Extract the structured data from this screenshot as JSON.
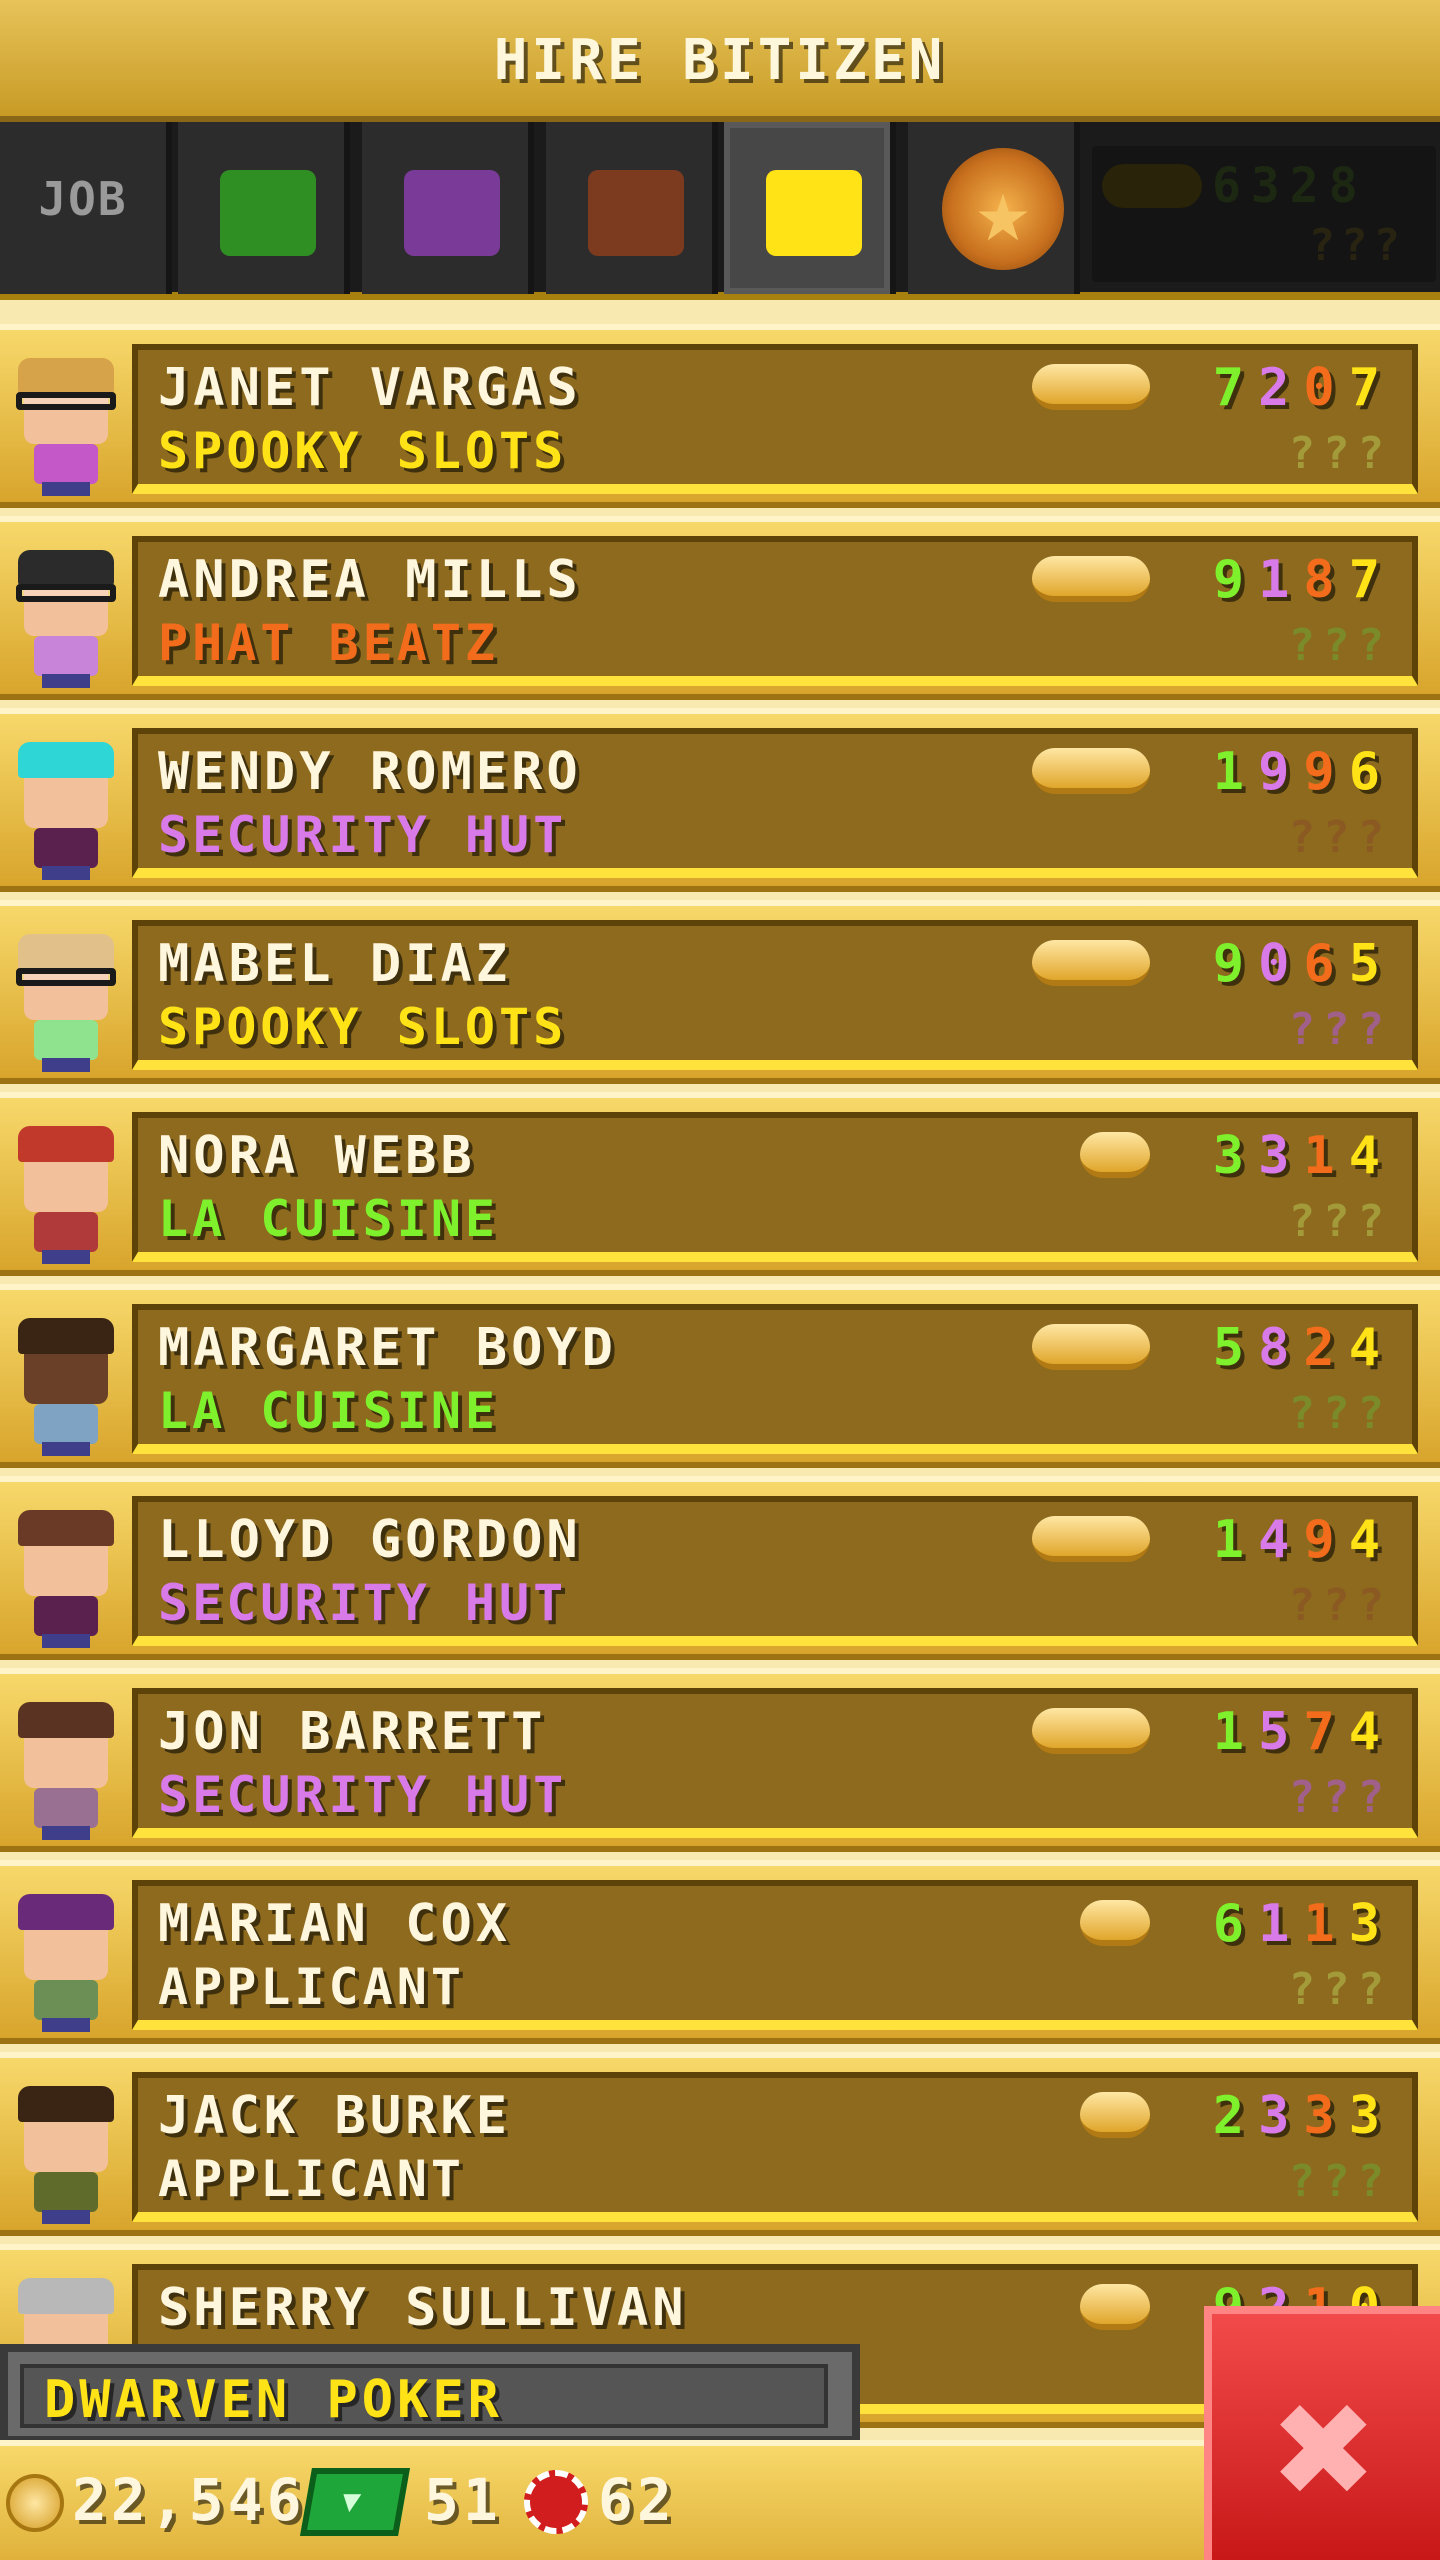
{
  "header": {
    "title": "HIRE BITIZEN"
  },
  "filters": {
    "job_label": "JOB",
    "tabs": [
      {
        "name": "food",
        "color": "#2f8f22"
      },
      {
        "name": "service",
        "color": "#7a3a98"
      },
      {
        "name": "recreation",
        "color": "#7c3a1e"
      },
      {
        "name": "retail",
        "color": "#ffe316",
        "active": true
      },
      {
        "name": "creative",
        "icon": "star-medal-icon"
      }
    ],
    "ghost_stats": "6328",
    "ghost_unknown": "???"
  },
  "bitizens": [
    {
      "name": "JANET VARGAS",
      "job": "SPOOKY SLOTS",
      "job_color": "#ffe316",
      "stats": [
        "7",
        "2",
        "0",
        "7"
      ],
      "coins": 3,
      "unknown": "???",
      "avatar": {
        "hair": "#d7a34a",
        "shirt": "#c558c9",
        "glasses": true
      }
    },
    {
      "name": "ANDREA MILLS",
      "job": "PHAT BEATZ",
      "job_color": "#f36c1c",
      "stats": [
        "9",
        "1",
        "8",
        "7"
      ],
      "coins": 4,
      "unknown": "???",
      "avatar": {
        "hair": "#2b2b2b",
        "shirt": "#c884d9",
        "glasses": true
      }
    },
    {
      "name": "WENDY ROMERO",
      "job": "SECURITY HUT",
      "job_color": "#d87ae8",
      "stats": [
        "1",
        "9",
        "9",
        "6"
      ],
      "coins": 4,
      "unknown": "???",
      "avatar": {
        "hair": "#2ed6d6",
        "shirt": "#5a214e",
        "glasses": false
      }
    },
    {
      "name": "MABEL DIAZ",
      "job": "SPOOKY SLOTS",
      "job_color": "#ffe316",
      "stats": [
        "9",
        "0",
        "6",
        "5"
      ],
      "coins": 3,
      "unknown": "???",
      "avatar": {
        "hair": "#e2c089",
        "shirt": "#8fe38f",
        "glasses": true
      }
    },
    {
      "name": "NORA WEBB",
      "job": "LA CUISINE",
      "job_color": "#7ef02c",
      "stats": [
        "3",
        "3",
        "1",
        "4"
      ],
      "coins": 2,
      "unknown": "???",
      "avatar": {
        "hair": "#c0392b",
        "shirt": "#b03a3a",
        "glasses": false
      }
    },
    {
      "name": "MARGARET BOYD",
      "job": "LA CUISINE",
      "job_color": "#7ef02c",
      "stats": [
        "5",
        "8",
        "2",
        "4"
      ],
      "coins": 3,
      "unknown": "???",
      "avatar": {
        "hair": "#3a2414",
        "shirt": "#7fa3c2",
        "glasses": false,
        "skin": "#6a4128"
      }
    },
    {
      "name": "LLOYD GORDON",
      "job": "SECURITY HUT",
      "job_color": "#d87ae8",
      "stats": [
        "1",
        "4",
        "9",
        "4"
      ],
      "coins": 3,
      "unknown": "???",
      "avatar": {
        "hair": "#6b3a26",
        "shirt": "#5a214e",
        "glasses": false
      }
    },
    {
      "name": "JON BARRETT",
      "job": "SECURITY HUT",
      "job_color": "#d87ae8",
      "stats": [
        "1",
        "5",
        "7",
        "4"
      ],
      "coins": 3,
      "unknown": "???",
      "avatar": {
        "hair": "#5a3322",
        "shirt": "#9a7092",
        "glasses": false
      }
    },
    {
      "name": "MARIAN COX",
      "job": "APPLICANT",
      "job_color": "#fff6de",
      "stats": [
        "6",
        "1",
        "1",
        "3"
      ],
      "coins": 2,
      "unknown": "???",
      "avatar": {
        "hair": "#6a2a7a",
        "shirt": "#6b8f55",
        "glasses": false
      }
    },
    {
      "name": "JACK BURKE",
      "job": "APPLICANT",
      "job_color": "#fff6de",
      "stats": [
        "2",
        "3",
        "3",
        "3"
      ],
      "coins": 2,
      "unknown": "???",
      "avatar": {
        "hair": "#3a2414",
        "shirt": "#5f6b2a",
        "glasses": false
      }
    },
    {
      "name": "SHERRY SULLIVAN",
      "job": "",
      "job_color": "#fff6de",
      "stats": [
        "9",
        "2",
        "1",
        "0"
      ],
      "coins": 2,
      "unknown": "???",
      "avatar": {
        "hair": "#b8b8b8",
        "shirt": "#7fa3c2",
        "glasses": false
      }
    }
  ],
  "stat_colors": [
    "#7ef02c",
    "#d87ae8",
    "#f36c1c",
    "#ffe316"
  ],
  "building": {
    "name": "DWARVEN POKER"
  },
  "currency": {
    "coins": "22,546",
    "bux": "51",
    "chips": "62"
  },
  "close_label": "✖"
}
